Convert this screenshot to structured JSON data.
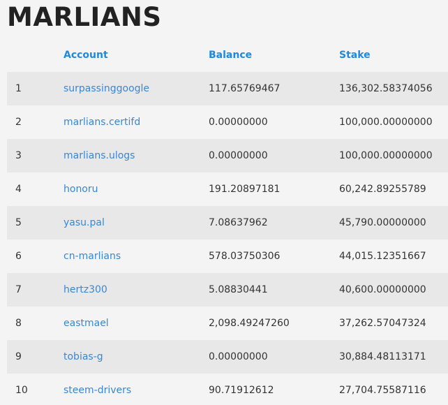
{
  "page": {
    "title": "MARLIANS"
  },
  "table": {
    "headers": {
      "rank": "",
      "account": "Account",
      "balance": "Balance",
      "stake": "Stake"
    },
    "rows": [
      {
        "rank": "1",
        "account": "surpassinggoogle",
        "balance": "117.65769467",
        "stake": "136,302.58374056"
      },
      {
        "rank": "2",
        "account": "marlians.certifd",
        "balance": "0.00000000",
        "stake": "100,000.00000000"
      },
      {
        "rank": "3",
        "account": "marlians.ulogs",
        "balance": "0.00000000",
        "stake": "100,000.00000000"
      },
      {
        "rank": "4",
        "account": "honoru",
        "balance": "191.20897181",
        "stake": "60,242.89255789"
      },
      {
        "rank": "5",
        "account": "yasu.pal",
        "balance": "7.08637962",
        "stake": "45,790.00000000"
      },
      {
        "rank": "6",
        "account": "cn-marlians",
        "balance": "578.03750306",
        "stake": "44,015.12351667"
      },
      {
        "rank": "7",
        "account": "hertz300",
        "balance": "5.08830441",
        "stake": "40,600.00000000"
      },
      {
        "rank": "8",
        "account": "eastmael",
        "balance": "2,098.49247260",
        "stake": "37,262.57047324"
      },
      {
        "rank": "9",
        "account": "tobias-g",
        "balance": "0.00000000",
        "stake": "30,884.48113171"
      },
      {
        "rank": "10",
        "account": "steem-drivers",
        "balance": "90.71912612",
        "stake": "27,704.75587116"
      }
    ]
  },
  "colors": {
    "link": "#3a86d6",
    "header": "#1e88e5",
    "row_alt": "#e8e8e8",
    "background": "#f4f4f4"
  }
}
